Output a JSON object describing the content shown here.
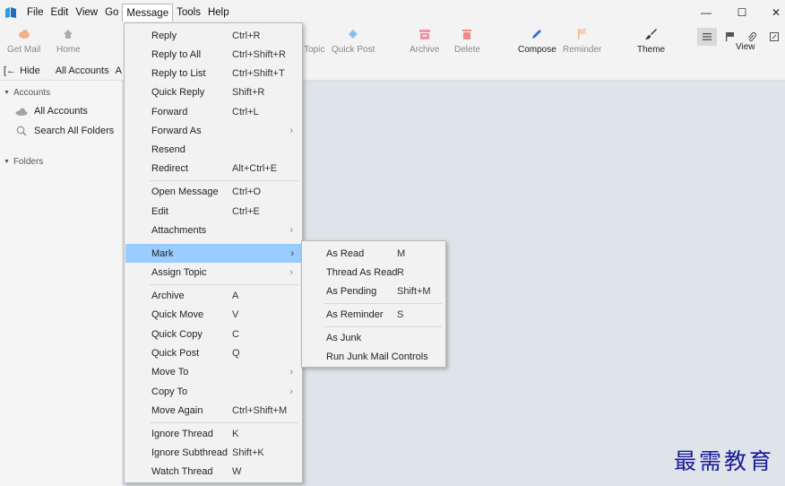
{
  "menubar": {
    "items": [
      {
        "label": "File"
      },
      {
        "label": "Edit"
      },
      {
        "label": "View"
      },
      {
        "label": "Go"
      },
      {
        "label": "Message"
      },
      {
        "label": "Tools"
      },
      {
        "label": "Help"
      }
    ],
    "active_index": 4,
    "window_controls": {
      "minimize": "—",
      "maximize": "☐",
      "close": "✕"
    }
  },
  "toolbar": {
    "buttons": [
      {
        "label": "Get Mail",
        "icon": "cloud-download-icon",
        "color": "#e8a078"
      },
      {
        "label": "Home",
        "icon": "home-icon",
        "color": "#9aa0a6"
      },
      {
        "label": "Topic",
        "icon": "",
        "color": ""
      },
      {
        "label": "Quick Post",
        "icon": "quick-post-icon",
        "color": "#6fa8dc"
      },
      {
        "label": "Archive",
        "icon": "archive-icon",
        "color": "#e86a8a"
      },
      {
        "label": "Delete",
        "icon": "delete-icon",
        "color": "#e86a6a"
      },
      {
        "label": "Compose",
        "icon": "compose-icon",
        "color": "#2f6fd1"
      },
      {
        "label": "Reminder",
        "icon": "reminder-flag-icon",
        "color": "#f0b78f"
      },
      {
        "label": "Theme",
        "icon": "theme-brush-icon",
        "color": "#333333"
      },
      {
        "label": "View",
        "icon": "",
        "color": ""
      }
    ]
  },
  "folderbar": {
    "hide_label": "Hide",
    "tab_label": "All Accounts",
    "tab_overflow": "A"
  },
  "sidebar": {
    "accounts_header": "Accounts",
    "all_accounts": "All Accounts",
    "search_all": "Search All Folders",
    "folders_header": "Folders"
  },
  "message_menu": {
    "items": [
      {
        "label": "Reply",
        "shortcut": "Ctrl+R",
        "submenu": false
      },
      {
        "label": "Reply to All",
        "shortcut": "Ctrl+Shift+R",
        "submenu": false
      },
      {
        "label": "Reply to List",
        "shortcut": "Ctrl+Shift+T",
        "submenu": false
      },
      {
        "label": "Quick Reply",
        "shortcut": "Shift+R",
        "submenu": false
      },
      {
        "label": "Forward",
        "shortcut": "Ctrl+L",
        "submenu": false
      },
      {
        "label": "Forward As",
        "shortcut": "",
        "submenu": true
      },
      {
        "label": "Resend",
        "shortcut": "",
        "submenu": false
      },
      {
        "label": "Redirect",
        "shortcut": "Alt+Ctrl+E",
        "submenu": false
      },
      {
        "label": "Open Message",
        "shortcut": "Ctrl+O",
        "submenu": false
      },
      {
        "label": "Edit",
        "shortcut": "Ctrl+E",
        "submenu": false
      },
      {
        "label": "Attachments",
        "shortcut": "",
        "submenu": true
      },
      {
        "label": "Mark",
        "shortcut": "",
        "submenu": true
      },
      {
        "label": "Assign Topic",
        "shortcut": "",
        "submenu": true
      },
      {
        "label": "Archive",
        "shortcut": "A",
        "submenu": false
      },
      {
        "label": "Quick Move",
        "shortcut": "V",
        "submenu": false
      },
      {
        "label": "Quick Copy",
        "shortcut": "C",
        "submenu": false
      },
      {
        "label": "Quick Post",
        "shortcut": "Q",
        "submenu": false
      },
      {
        "label": "Move To",
        "shortcut": "",
        "submenu": true
      },
      {
        "label": "Copy To",
        "shortcut": "",
        "submenu": true
      },
      {
        "label": "Move Again",
        "shortcut": "Ctrl+Shift+M",
        "submenu": false
      },
      {
        "label": "Ignore Thread",
        "shortcut": "K",
        "submenu": false
      },
      {
        "label": "Ignore Subthread",
        "shortcut": "Shift+K",
        "submenu": false
      },
      {
        "label": "Watch Thread",
        "shortcut": "W",
        "submenu": false
      }
    ],
    "highlighted_index": 11
  },
  "mark_submenu": {
    "items": [
      {
        "label": "As Read",
        "shortcut": "M"
      },
      {
        "label": "Thread As Read",
        "shortcut": "R"
      },
      {
        "label": "As Pending",
        "shortcut": "Shift+M"
      },
      {
        "label": "As Reminder",
        "shortcut": "S"
      },
      {
        "label": "As Junk",
        "shortcut": ""
      },
      {
        "label": "Run Junk Mail Controls",
        "shortcut": ""
      }
    ]
  },
  "watermark": {
    "text": "最需教育"
  },
  "colors": {
    "highlight": "#99ccff",
    "menu_bg": "#f2f2f2",
    "content_bg": "#dfe3ea"
  }
}
